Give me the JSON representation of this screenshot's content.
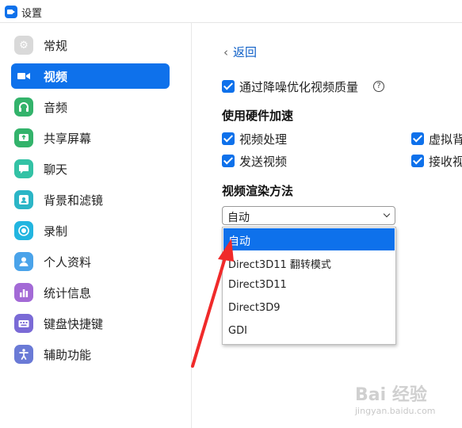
{
  "window": {
    "title": "设置"
  },
  "sidebar": {
    "items": [
      {
        "label": "常规",
        "icon": "gear-icon",
        "color": "#d9d9d9",
        "glyph": "⚙"
      },
      {
        "label": "视频",
        "icon": "video-camera-icon",
        "color": "#0e71eb",
        "glyph": "■",
        "active": true
      },
      {
        "label": "音频",
        "icon": "headphones-icon",
        "color": "#33b36b",
        "glyph": "♫"
      },
      {
        "label": "共享屏幕",
        "icon": "share-screen-icon",
        "color": "#33b36b",
        "glyph": "↑"
      },
      {
        "label": "聊天",
        "icon": "chat-bubble-icon",
        "color": "#33c2a5",
        "glyph": "▭"
      },
      {
        "label": "背景和滤镜",
        "icon": "background-filter-icon",
        "color": "#2bb5c6",
        "glyph": "▣"
      },
      {
        "label": "录制",
        "icon": "record-icon",
        "color": "#22b5e0",
        "glyph": "◉"
      },
      {
        "label": "个人资料",
        "icon": "profile-icon",
        "color": "#4aa3ea",
        "glyph": "●"
      },
      {
        "label": "统计信息",
        "icon": "statistics-icon",
        "color": "#a36ad6",
        "glyph": "▮"
      },
      {
        "label": "键盘快捷键",
        "icon": "keyboard-icon",
        "color": "#7a6ad6",
        "glyph": "⌨"
      },
      {
        "label": "辅助功能",
        "icon": "accessibility-icon",
        "color": "#6a7ad6",
        "glyph": "♿"
      }
    ]
  },
  "main": {
    "back_label": "返回",
    "noise_option": {
      "label": "通过降噪优化视频质量",
      "checked": true
    },
    "hw_accel": {
      "title": "使用硬件加速",
      "options": [
        {
          "label": "视频处理",
          "checked": true
        },
        {
          "label": "虚拟背",
          "checked": true
        },
        {
          "label": "发送视频",
          "checked": true
        },
        {
          "label": "接收视",
          "checked": true
        }
      ]
    },
    "render": {
      "title": "视频渲染方法",
      "selected": "自动",
      "options": [
        "自动",
        "Direct3D11 翻转模式",
        "Direct3D11",
        "Direct3D9",
        "GDI"
      ]
    }
  },
  "watermark": {
    "text": "Bai 经验",
    "sub": "jingyan.baidu.com"
  },
  "colors": {
    "accent": "#0e71eb",
    "annotation_arrow": "#f02a2a"
  }
}
